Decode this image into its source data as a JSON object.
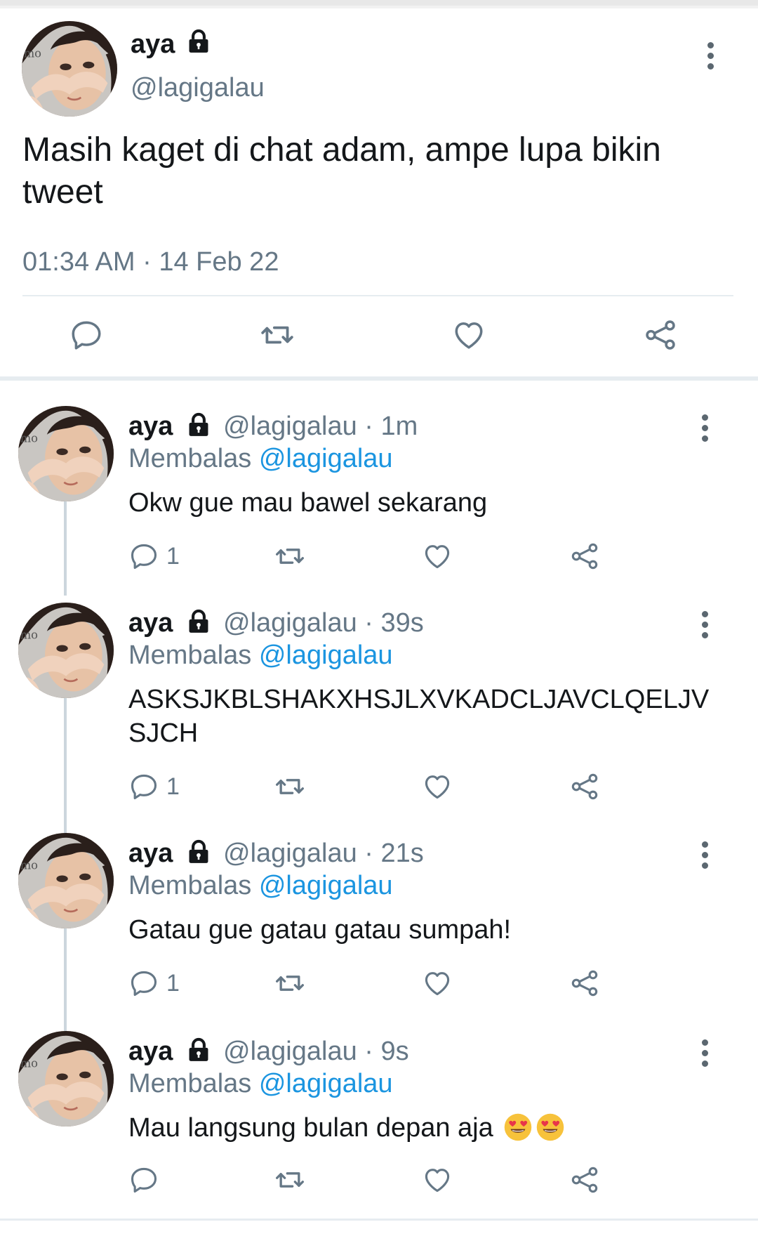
{
  "main_tweet": {
    "name": "aya",
    "handle": "@lagigalau",
    "text": "Masih kaget di chat adam, ampe lupa bikin tweet",
    "timestamp": "01:34 AM · 14 Feb 22",
    "avatar_icon": "profile-photo",
    "lock_icon": "lock-icon",
    "more_icon": "more-vertical-icon"
  },
  "actions": {
    "reply_icon": "reply-icon",
    "retweet_icon": "retweet-icon",
    "like_icon": "heart-icon",
    "share_icon": "share-icon"
  },
  "replies": [
    {
      "name": "aya",
      "handle_time": "@lagigalau · 1m",
      "replying_prefix": "Membalas",
      "replying_mention": "@lagigalau",
      "text": "Okw gue mau bawel sekarang",
      "reply_count": "1"
    },
    {
      "name": "aya",
      "handle_time": "@lagigalau · 39s",
      "replying_prefix": "Membalas",
      "replying_mention": "@lagigalau",
      "text": "ASKSJKBLSHAKXHSJLXVKADCLJAVCLQELJVSJCH",
      "reply_count": "1"
    },
    {
      "name": "aya",
      "handle_time": "@lagigalau · 21s",
      "replying_prefix": "Membalas",
      "replying_mention": "@lagigalau",
      "text": "Gatau gue gatau gatau sumpah!",
      "reply_count": "1"
    },
    {
      "name": "aya",
      "handle_time": "@lagigalau · 9s",
      "replying_prefix": "Membalas",
      "replying_mention": "@lagigalau",
      "text": "Mau langsung bulan depan aja",
      "text_emojis": [
        "heart-eyes-emoji",
        "heart-eyes-emoji"
      ],
      "reply_count": ""
    }
  ],
  "colors": {
    "text": "#14171a",
    "secondary": "#657786",
    "link": "#1b95e0",
    "divider": "#e6ecf0",
    "icon": "#657786"
  }
}
